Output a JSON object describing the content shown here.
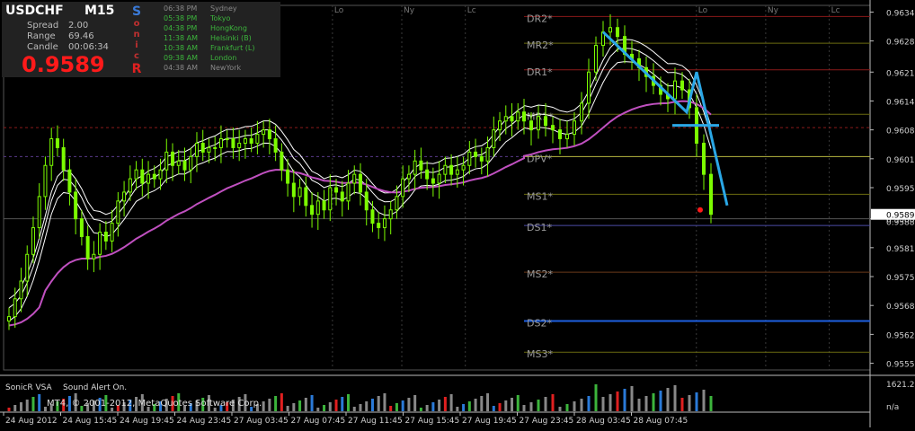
{
  "chart_data": {
    "type": "candlestick",
    "symbol": "USDCHF",
    "timeframe": "M15",
    "ylim": [
      0.9554,
      0.9636
    ],
    "y_ticks": [
      0.96345,
      0.9628,
      0.9621,
      0.96145,
      0.9608,
      0.96015,
      0.9595,
      0.9588,
      0.95815,
      0.9575,
      0.95685,
      0.9562,
      0.95555
    ],
    "y_tick_labels": [
      "0.96345",
      "0.96280",
      "0.96210",
      "0.96145",
      "0.96080",
      "0.96015",
      "0.95950",
      "0.95880",
      "0.95815",
      "0.95750",
      "0.95685",
      "0.95620",
      "0.95555"
    ],
    "current_price_label": "0.95899",
    "current_price_label2": "0.95880",
    "x_tick_labels": [
      "24 Aug 2012",
      "24 Aug 15:45",
      "24 Aug 19:45",
      "24 Aug 23:45",
      "27 Aug 03:45",
      "27 Aug 07:45",
      "27 Aug 11:45",
      "27 Aug 15:45",
      "27 Aug 19:45",
      "27 Aug 23:45",
      "28 Aug 03:45",
      "28 Aug 07:45"
    ],
    "session_labels": [
      {
        "label": "Lo",
        "index": 56
      },
      {
        "label": "Ny",
        "index": 68
      },
      {
        "label": "Lc",
        "index": 79
      },
      {
        "label": "Lo",
        "index": 119
      },
      {
        "label": "Ny",
        "index": 131
      },
      {
        "label": "Lc",
        "index": 142
      }
    ],
    "pivot_levels": [
      {
        "label": "DR2*",
        "value": 0.96335,
        "color": "#8b1a1a"
      },
      {
        "label": "MR2*",
        "value": 0.96275,
        "color": "#6b6b10"
      },
      {
        "label": "DR1*",
        "value": 0.96215,
        "color": "#8b1a1a"
      },
      {
        "label": "MR1*",
        "value": 0.96115,
        "color": "#6b6b10"
      },
      {
        "label": "DPV*",
        "value": 0.9602,
        "color": "#b8b840"
      },
      {
        "label": "MS1*",
        "value": 0.95935,
        "color": "#6b6b10"
      },
      {
        "label": "DS1*",
        "value": 0.95865,
        "color": "#4c4ca8"
      },
      {
        "label": "MS2*",
        "value": 0.9576,
        "color": "#6b3b1a"
      },
      {
        "label": "DS2*",
        "value": 0.9565,
        "color": "#1e5fe0"
      },
      {
        "label": "MS3*",
        "value": 0.9558,
        "color": "#6b6b10"
      }
    ],
    "candles_close": [
      0.9566,
      0.957,
      0.9574,
      0.958,
      0.9586,
      0.9593,
      0.96,
      0.9606,
      0.9604,
      0.9599,
      0.9594,
      0.9588,
      0.9584,
      0.9579,
      0.958,
      0.9585,
      0.9583,
      0.9587,
      0.9592,
      0.9594,
      0.9597,
      0.9599,
      0.9596,
      0.9598,
      0.9597,
      0.9599,
      0.9603,
      0.96,
      0.9601,
      0.9599,
      0.9602,
      0.9605,
      0.9603,
      0.9604,
      0.9604,
      0.9606,
      0.9606,
      0.9604,
      0.9605,
      0.9606,
      0.9605,
      0.9607,
      0.9608,
      0.9606,
      0.9603,
      0.9599,
      0.9596,
      0.9593,
      0.9595,
      0.9591,
      0.9589,
      0.9592,
      0.959,
      0.9595,
      0.9594,
      0.9592,
      0.9596,
      0.9598,
      0.9594,
      0.959,
      0.9587,
      0.9586,
      0.9588,
      0.959,
      0.9593,
      0.9597,
      0.9598,
      0.9601,
      0.9599,
      0.9597,
      0.9596,
      0.9598,
      0.96,
      0.9598,
      0.9599,
      0.96,
      0.9603,
      0.9602,
      0.9601,
      0.9604,
      0.9608,
      0.961,
      0.9611,
      0.961,
      0.9612,
      0.9612,
      0.961,
      0.9608,
      0.9611,
      0.9609,
      0.9608,
      0.9606,
      0.9607,
      0.961,
      0.9614,
      0.9621,
      0.9627,
      0.963,
      0.9631,
      0.9629,
      0.9625,
      0.9624,
      0.9622,
      0.962,
      0.9618,
      0.9616,
      0.9615,
      0.9619,
      0.9617,
      0.9613,
      0.9605,
      0.9598,
      0.9589
    ],
    "series": [
      {
        "name": "",
        "color": "#c050c0"
      },
      {
        "name": "",
        "color": "#ffffff"
      }
    ],
    "trend_lines": [
      {
        "color": "#2aa7e6",
        "points": [
          [
            0.963,
            0
          ],
          [
            0.9612,
            1
          ],
          [
            0.9621,
            2
          ],
          [
            0.959,
            3
          ]
        ]
      },
      {
        "color": "#2aa7e6",
        "points": [
          [
            0.9609,
            0
          ],
          [
            0.9609,
            1
          ]
        ]
      }
    ],
    "current_marker": 0.959,
    "volume_label": "SonicR VSA",
    "volume_alert": "Sound Alert On.",
    "volume_scale_top": "1621.2",
    "volume_scale_bottom": "n/a"
  },
  "info_panel": {
    "symbol": "USDCHF",
    "timeframe": "M15",
    "spread_label": "Spread",
    "spread_value": "2.00",
    "range_label": "Range",
    "range_value": "69.46",
    "candle_label": "Candle",
    "candle_value": "00:06:34",
    "price": "0.9589",
    "brand_letters": [
      "S",
      "o",
      "n",
      "i",
      "c",
      "R"
    ],
    "sessions": [
      {
        "time": "06:38 PM",
        "name": "Sydney",
        "color": "#888888"
      },
      {
        "time": "05:38 PM",
        "name": "Tokyo",
        "color": "#3cb43c"
      },
      {
        "time": "04:38 PM",
        "name": "HongKong",
        "color": "#3cb43c"
      },
      {
        "time": "11:38 AM",
        "name": "Helsinki  (B)",
        "color": "#3cb43c"
      },
      {
        "time": "10:38 AM",
        "name": "Frankfurt  (L)",
        "color": "#3cb43c"
      },
      {
        "time": "09:38 AM",
        "name": "London",
        "color": "#3cb43c"
      },
      {
        "time": "04:38 AM",
        "name": "NewYork",
        "color": "#888888"
      }
    ]
  },
  "footer": {
    "copyright": "MT4, © 2001-2012, MetaQuotes Software Corp."
  },
  "colors": {
    "bull": "#7cfc00",
    "bear": "#ffffff",
    "grid": "#2a2a2a",
    "axis": "#cfcfcf",
    "price": "#ff1a1a"
  }
}
